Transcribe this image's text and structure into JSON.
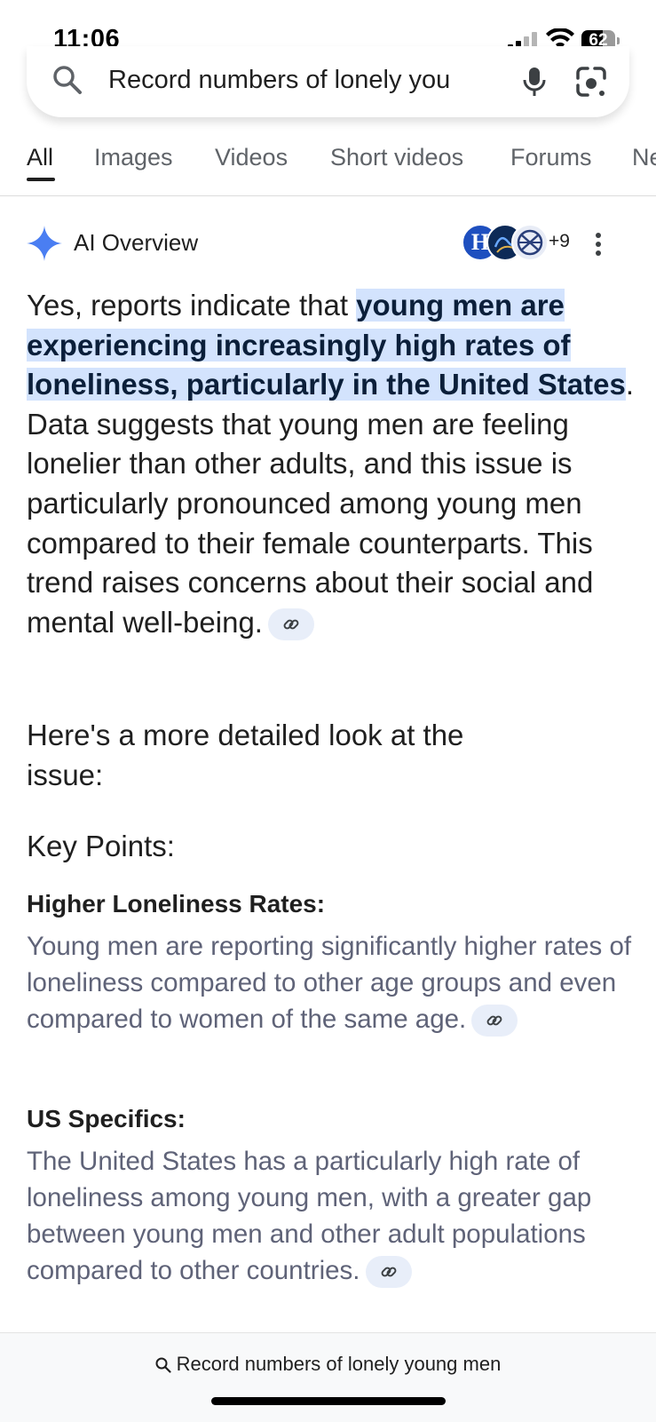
{
  "status_bar": {
    "time": "11:06",
    "battery": "62",
    "battery_level": 0.62
  },
  "search": {
    "query": "Record numbers of lonely you"
  },
  "tabs": [
    {
      "label": "All",
      "active": true
    },
    {
      "label": "Images"
    },
    {
      "label": "Videos"
    },
    {
      "label": "Short videos"
    },
    {
      "label": "Forums"
    },
    {
      "label": "Ne"
    }
  ],
  "ai_overview": {
    "title": "AI Overview",
    "source_initial": "H",
    "more_sources": "+9",
    "intro_before": "Yes, reports indicate that ",
    "intro_highlight": "young men are experiencing increasingly high rates of loneliness, particularly in the United States",
    "intro_after": ". Data suggests that young men are feeling lonelier than other adults, and this issue is particularly pronounced among young men compared to their female counterparts. This trend raises concerns about their social and mental well-being.",
    "detail_intro": "Here's a more detailed look at the issue:",
    "key_points_heading": "Key Points:",
    "points": [
      {
        "heading": "Higher Loneliness Rates:",
        "text": "Young men are reporting significantly higher rates of loneliness compared to other age groups and even compared to women of the same age."
      },
      {
        "heading": "US Specifics:",
        "text": "The United States has a particularly high rate of loneliness among young men, with a greater gap between young men and other adult populations compared to other countries."
      }
    ]
  },
  "bottom_bar": {
    "query": "Record numbers of lonely young men"
  },
  "colors": {
    "highlight": "#d3e3fd",
    "accent": "#4285f4",
    "muted_text": "#5f6378"
  }
}
